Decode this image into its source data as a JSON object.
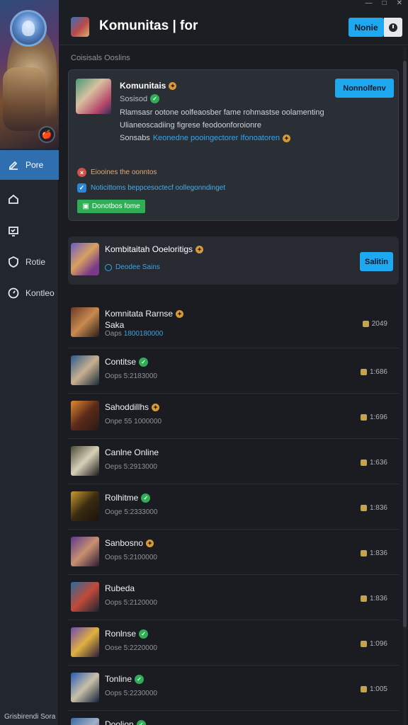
{
  "window": {
    "minimize": "—",
    "maximize": "□",
    "close": "✕"
  },
  "header": {
    "title": "Komunitas | for",
    "button_label": "Nonie"
  },
  "sidebar": {
    "items": [
      {
        "label": "Pore",
        "icon": "edit-icon",
        "active": true
      },
      {
        "label": "",
        "icon": "home-icon",
        "active": false
      },
      {
        "label": "",
        "icon": "screen-icon",
        "active": false
      },
      {
        "label": "Rotie",
        "icon": "shield-icon",
        "active": false
      },
      {
        "label": "Kontleo",
        "icon": "gauge-icon",
        "active": false
      }
    ],
    "hero_badge": "🍎",
    "footer": "Grisbirendi Sora"
  },
  "section_label": "Coisisals Ooslins",
  "featured": {
    "title": "Komunitais",
    "subtitle": "Sosisod",
    "desc1": "Rlamsasr ootone oolfeaosber fame rohmastse oolamenting",
    "desc2": "Ulianeoscadiing figrese feodoonforoionre",
    "desc3_prefix": "Sonsabs",
    "desc3_link": "Keonedne pooingectorer Ifonoatoren",
    "button": "Nonnolfenv",
    "flag_red": "Eiooines the oonntos",
    "flag_blue": "Noticittoms beppcesoctecf oollegonndinget",
    "tag": "Donotbos fome"
  },
  "featured2": {
    "title": "Kombitaitah Ooeloritigs",
    "subtitle": "Deodee Sains",
    "button": "Salitin"
  },
  "rows": [
    {
      "name": "Komnitata Rarnse",
      "name2": "Saka",
      "badge": "gold",
      "sub": "Oaps",
      "sub_hl": "1800180000",
      "metric": "2049",
      "colors": [
        "#6a3a28",
        "#c88a50",
        "#2a1c18"
      ]
    },
    {
      "name": "Contitse",
      "name2": "",
      "badge": "green",
      "sub": "Oops 5:2183000",
      "sub_hl": "",
      "metric": "1:686",
      "colors": [
        "#2a5a8a",
        "#c8b090",
        "#1a2a3a"
      ]
    },
    {
      "name": "Sahoddillhs",
      "name2": "",
      "badge": "gold",
      "sub": "Onpe 55 1000000",
      "sub_hl": "",
      "metric": "1:696",
      "colors": [
        "#e08a30",
        "#5a2a1a",
        "#2a1a14"
      ]
    },
    {
      "name": "Canlne Online",
      "name2": "",
      "badge": "",
      "sub": "Oeps 5:2913000",
      "sub_hl": "",
      "metric": "1:636",
      "colors": [
        "#4a4a3a",
        "#d8d0b8",
        "#1a1a18"
      ]
    },
    {
      "name": "Rolhitme",
      "name2": "",
      "badge": "green",
      "sub": "Ooge 5:2333000",
      "sub_hl": "",
      "metric": "1:836",
      "colors": [
        "#c89a30",
        "#3a2a10",
        "#1a140c"
      ]
    },
    {
      "name": "Sanbosno",
      "name2": "",
      "badge": "gold",
      "sub": "Oops 5:2100000",
      "sub_hl": "",
      "metric": "1:836",
      "colors": [
        "#5a3a8a",
        "#c89070",
        "#2a1a34"
      ]
    },
    {
      "name": "Rubeda",
      "name2": "",
      "badge": "",
      "sub": "Oops 5:2120000",
      "sub_hl": "",
      "metric": "1:836",
      "colors": [
        "#2a6a9a",
        "#c04a3a",
        "#1a2430"
      ]
    },
    {
      "name": "Ronlnse",
      "name2": "",
      "badge": "green",
      "sub": "Oose 5:2220000",
      "sub_hl": "",
      "metric": "1:096",
      "colors": [
        "#6a4ab0",
        "#e0b040",
        "#2a1c3a"
      ]
    },
    {
      "name": "Tonline",
      "name2": "",
      "badge": "green",
      "sub": "Oops 5:2230000",
      "sub_hl": "",
      "metric": "1:005",
      "colors": [
        "#2a5ab0",
        "#c8c0a8",
        "#142038"
      ]
    },
    {
      "name": "Doolion",
      "name2": "",
      "badge": "green",
      "sub": "",
      "sub_hl": "",
      "metric": "",
      "colors": [
        "#3a6aa0",
        "#a0b0c8",
        "#1a2030"
      ]
    }
  ],
  "colors": {
    "accent": "#1ea8f0",
    "sidebar_active": "#2f6fb0",
    "success": "#2fae56",
    "gold": "#d79a3a"
  }
}
